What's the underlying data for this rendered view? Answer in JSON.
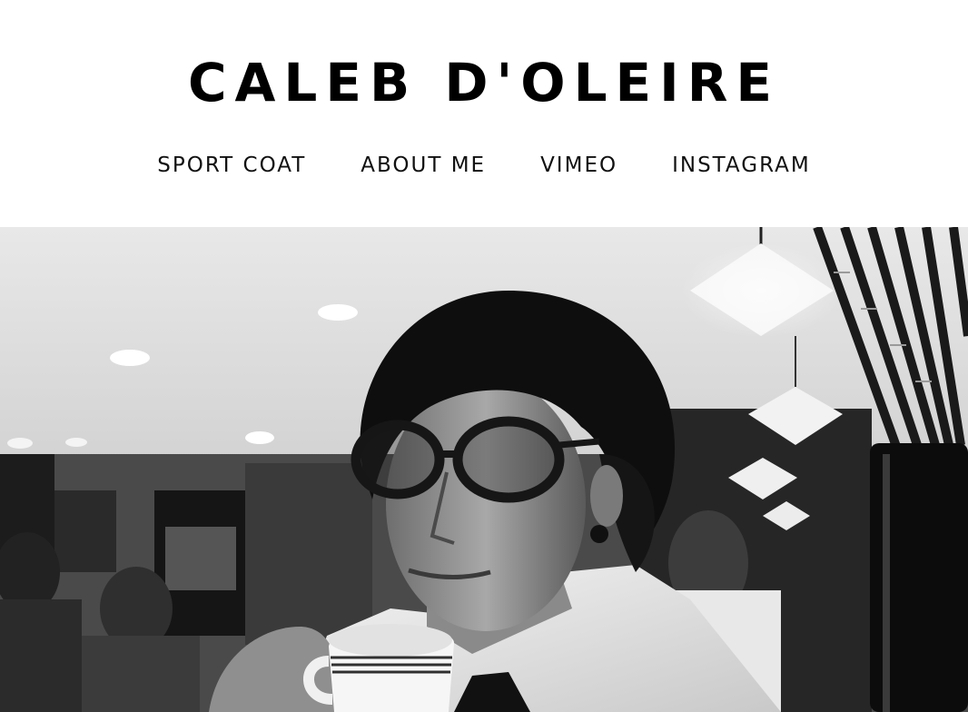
{
  "site": {
    "title": "CALEB D'OLEIRE"
  },
  "nav": {
    "items": [
      {
        "label": "SPORT COAT"
      },
      {
        "label": "ABOUT ME"
      },
      {
        "label": "VIMEO"
      },
      {
        "label": "INSTAGRAM"
      }
    ]
  },
  "hero": {
    "style": "black-and-white portrait photo",
    "colors": {
      "background": "#ffffff",
      "text": "#000000"
    }
  }
}
